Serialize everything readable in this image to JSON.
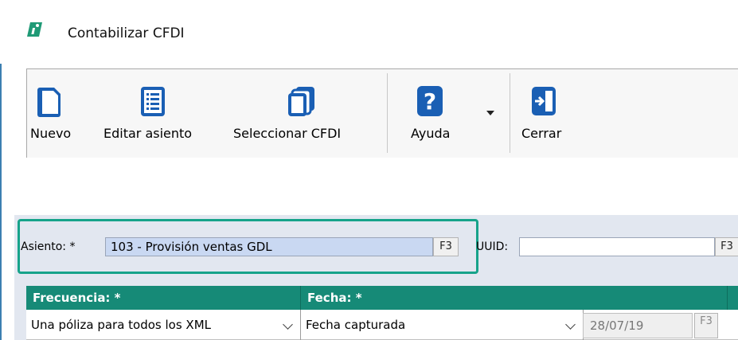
{
  "window": {
    "title": "Contabilizar CFDI"
  },
  "toolbar": {
    "nuevo": "Nuevo",
    "editar_asiento": "Editar asiento",
    "seleccionar_cfdi": "Seleccionar CFDI",
    "ayuda": "Ayuda",
    "cerrar": "Cerrar"
  },
  "form": {
    "asiento_label": "Asiento: *",
    "asiento_value": "103 - Provisión ventas GDL",
    "asiento_key": "F3",
    "uuid_label": "UUID:",
    "uuid_value": "",
    "uuid_key": "F3"
  },
  "grid": {
    "columns": [
      "Frecuencia: *",
      "Fecha: *"
    ],
    "row": {
      "frecuencia": "Una póliza para todos los XML",
      "fecha_tipo": "Fecha capturada",
      "fecha": "28/07/19",
      "fecha_key": "F3"
    }
  },
  "colors": {
    "accent": "#168a77",
    "highlight_border": "#16a38a",
    "icon_blue": "#1a5fb4",
    "selected_field": "#c9d8f2"
  }
}
